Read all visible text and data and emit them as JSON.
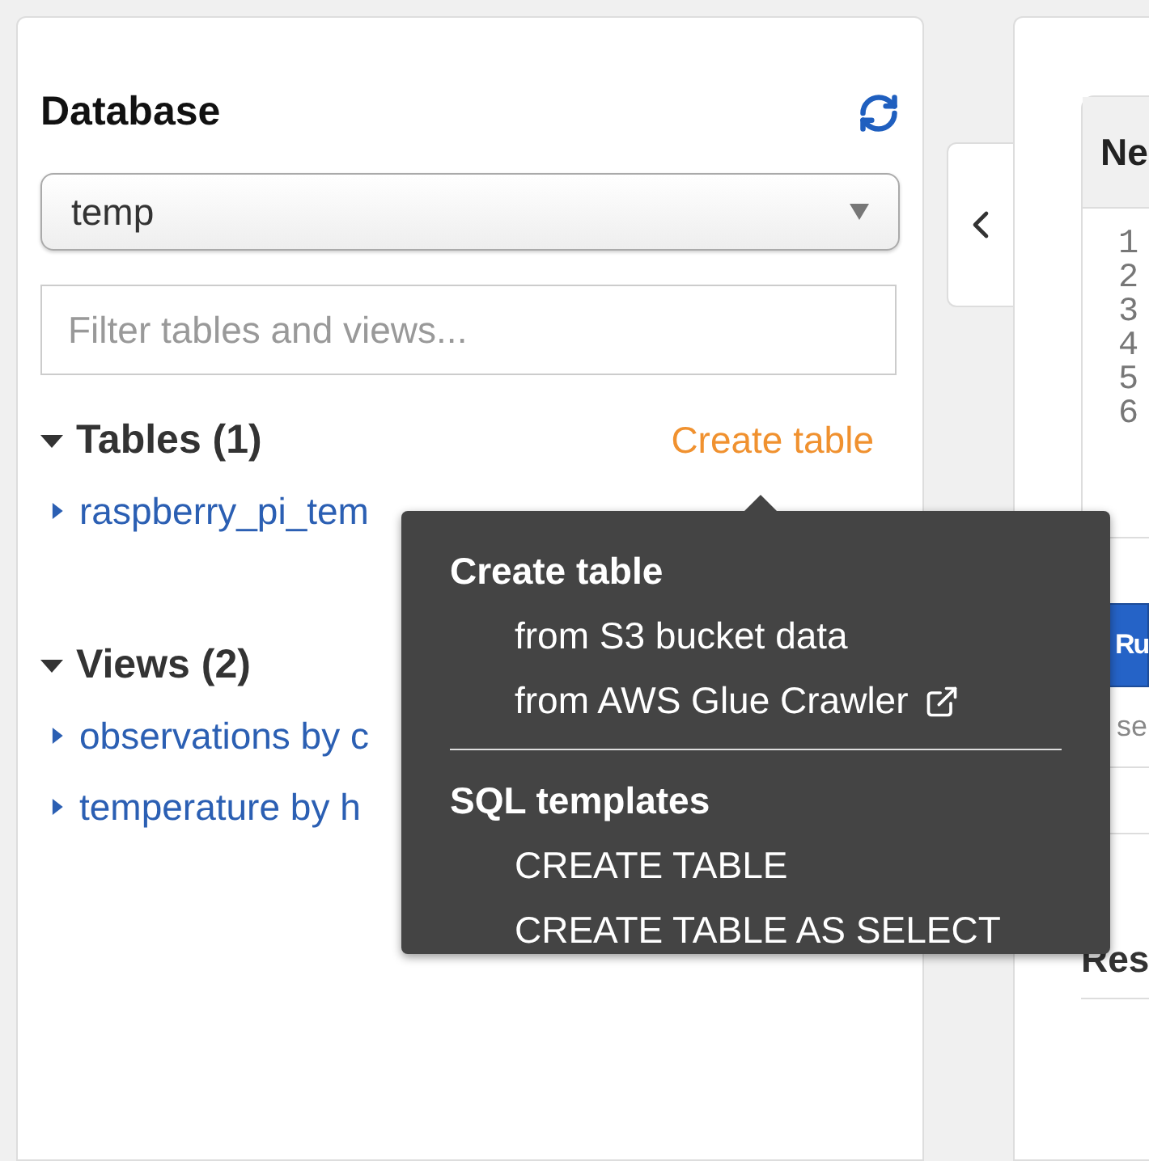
{
  "sidebar": {
    "title": "Database",
    "database_select": {
      "value": "temp"
    },
    "filter": {
      "placeholder": "Filter tables and views..."
    },
    "sections": [
      {
        "label": "Tables (1)",
        "expanded": true,
        "action": "Create table",
        "items": [
          {
            "label": "raspberry_pi_tem",
            "expanded": false
          }
        ]
      },
      {
        "label": "Views (2)",
        "expanded": true,
        "items": [
          {
            "label": "observations by c",
            "expanded": false
          },
          {
            "label": "temperature by h",
            "expanded": false
          }
        ]
      }
    ]
  },
  "popover": {
    "groups": [
      {
        "title": "Create table",
        "items": [
          {
            "label": "from S3 bucket data",
            "external": false
          },
          {
            "label": "from AWS Glue Crawler",
            "external": true
          }
        ]
      },
      {
        "title": "SQL templates",
        "items": [
          {
            "label": "CREATE TABLE",
            "external": false
          },
          {
            "label": "CREATE TABLE AS SELECT",
            "external": false
          }
        ]
      }
    ]
  },
  "editor": {
    "header": "Ne",
    "line_numbers": [
      "1",
      "2",
      "3",
      "4",
      "5",
      "6"
    ],
    "run_button": "Ru",
    "note": "se",
    "results_heading": "Res"
  }
}
